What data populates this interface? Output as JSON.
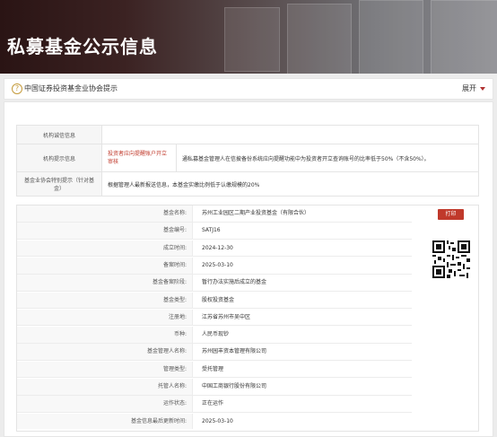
{
  "hero": {
    "title": "私募基金公示信息"
  },
  "notice": {
    "icon": "question-circle-icon",
    "text": "中国证券投资基金业协会提示",
    "expand_label": "展开"
  },
  "tips": [
    {
      "label": "机构诚信信息",
      "flag": "",
      "value": ""
    },
    {
      "label": "机构提示信息",
      "flag": "投资者应向提醒账户开立\n审核",
      "value": "通私募基金管理人在信披备份系统应向提醒功能中为投资者开立查询账号的比率低于50%（不含50%）。"
    },
    {
      "label": "基金业协会特别提示（针对基金）",
      "flag": "",
      "value": "根据管理人最新报送信息，本基金实缴比例低于认缴规模的20%"
    }
  ],
  "fund": {
    "print_label": "打印",
    "rows": [
      {
        "key": "基金名称:",
        "value": "苏州工业园区二期产业投资基金（有限合伙）"
      },
      {
        "key": "基金编号:",
        "value": "SATJ16"
      },
      {
        "key": "成立时间:",
        "value": "2024-12-30"
      },
      {
        "key": "备案时间:",
        "value": "2025-03-10"
      },
      {
        "key": "基金备案阶段:",
        "value": "暂行办法实施后成立的基金"
      },
      {
        "key": "基金类型:",
        "value": "股权投资基金"
      },
      {
        "key": "注册地:",
        "value": "江苏省苏州市吴中区"
      },
      {
        "key": "币种:",
        "value": "人民币现钞"
      },
      {
        "key": "基金管理人名称:",
        "value": "苏州园丰资本管理有限公司"
      },
      {
        "key": "管理类型:",
        "value": "受托管理"
      },
      {
        "key": "托管人名称:",
        "value": "中国工商银行股份有限公司"
      },
      {
        "key": "运作状态:",
        "value": "正在运作"
      },
      {
        "key": "基金信息最后更新时间:",
        "value": "2025-03-10"
      }
    ]
  },
  "colors": {
    "accent": "#c0392b",
    "hero_dark": "#2a1414"
  }
}
